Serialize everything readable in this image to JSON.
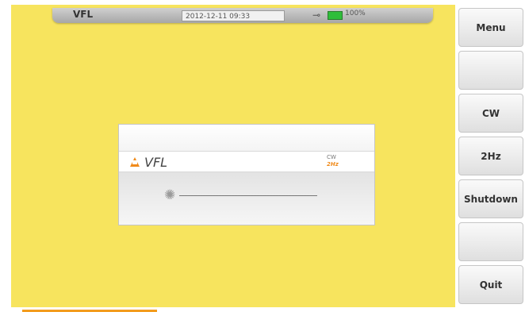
{
  "status_bar": {
    "mode_title": "VFL",
    "datetime": "2012-12-11 09:33",
    "battery_percent": "100%",
    "battery_color": "#2fbd3a"
  },
  "vfl_panel": {
    "label": "VFL",
    "mode_cw": "CW",
    "mode_2hz": "2Hz",
    "warning_icon": "laser-warning-icon",
    "burst_icon": "light-burst-icon"
  },
  "sidebar": {
    "buttons": [
      {
        "label": "Menu"
      },
      {
        "label": ""
      },
      {
        "label": "CW"
      },
      {
        "label": "2Hz"
      },
      {
        "label": "Shutdown"
      },
      {
        "label": ""
      },
      {
        "label": "Quit"
      }
    ]
  },
  "colors": {
    "background": "#f7e45e",
    "accent": "#f39c1d"
  }
}
